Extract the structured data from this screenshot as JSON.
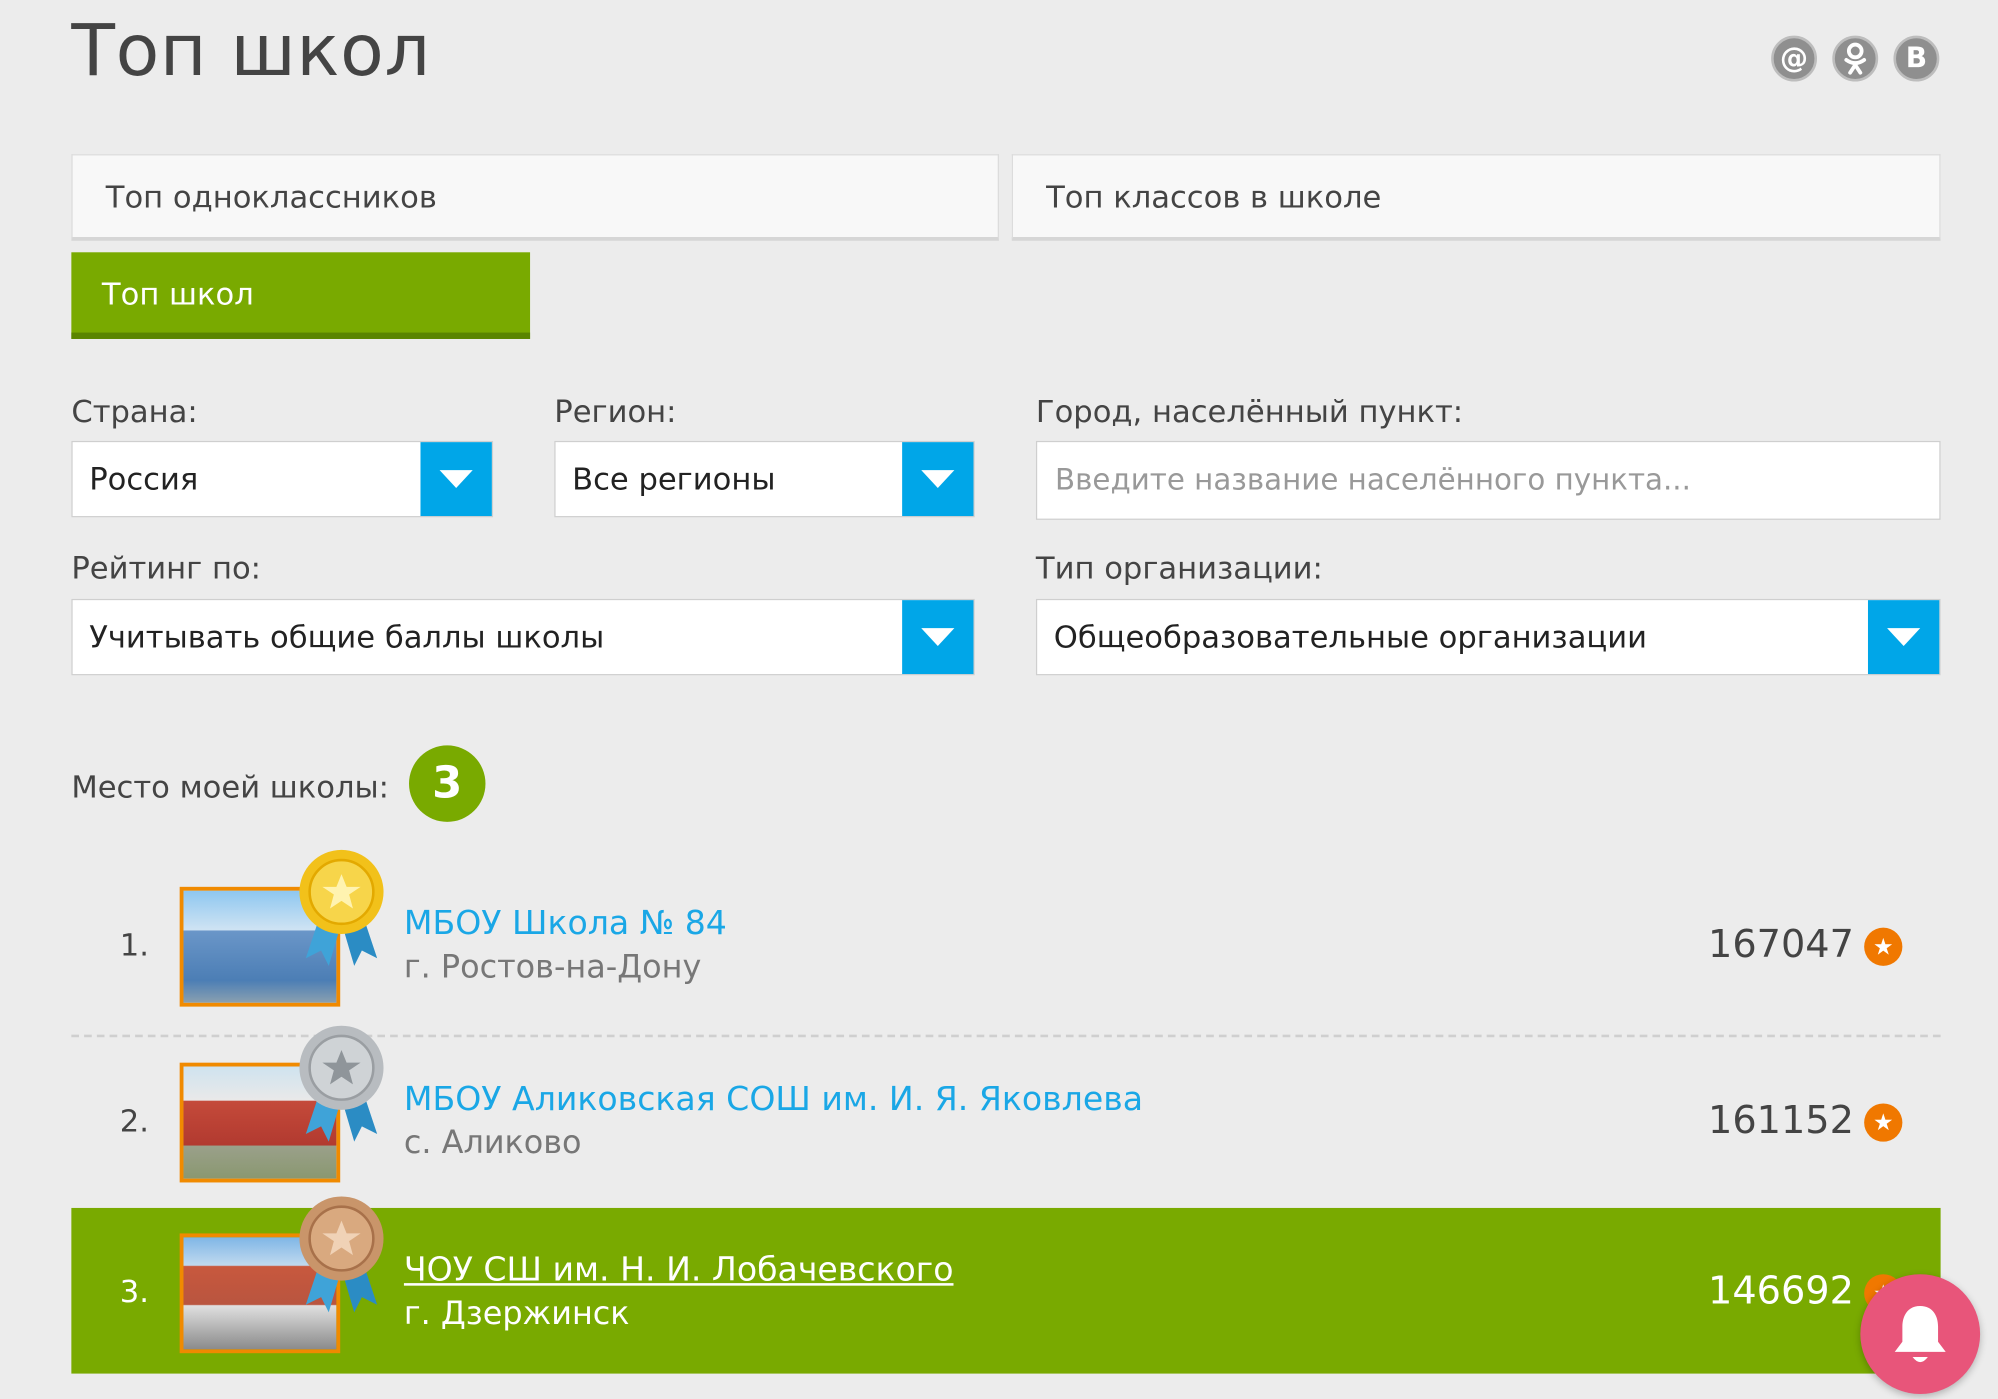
{
  "page": {
    "title": "Топ школ"
  },
  "social": [
    {
      "icon": "mail-icon",
      "glyph": "@"
    },
    {
      "icon": "odnoklassniki-icon",
      "glyph": "ок"
    },
    {
      "icon": "vk-icon",
      "glyph": "В"
    }
  ],
  "tabs": [
    {
      "label": "Топ одноклассников",
      "active": false
    },
    {
      "label": "Топ классов в школе",
      "active": false
    },
    {
      "label": "Топ школ",
      "active": true
    }
  ],
  "filters": {
    "country": {
      "label": "Страна:",
      "value": "Россия"
    },
    "region": {
      "label": "Регион:",
      "value": "Все регионы"
    },
    "city": {
      "label": "Город, населённый пункт:",
      "placeholder": "Введите название населённого пункта..."
    },
    "rating": {
      "label": "Рейтинг по:",
      "value": "Учитывать общие баллы школы"
    },
    "org_type": {
      "label": "Тип организации:",
      "value": "Общеобразовательные организации"
    }
  },
  "my_place": {
    "label": "Место моей школы:",
    "value": "3"
  },
  "schools": [
    {
      "rank": "1.",
      "name": "МБОУ Школа № 84",
      "city": "г. Ростов-на-Дону",
      "score": "167047",
      "medal": "gold"
    },
    {
      "rank": "2.",
      "name": "МБОУ Аликовская СОШ им. И. Я. Яковлева",
      "city": "с. Аликово",
      "score": "161152",
      "medal": "silver"
    },
    {
      "rank": "3.",
      "name": "ЧОУ СШ им. Н. И. Лобачевского",
      "city": "г. Дзержинск",
      "score": "146692",
      "medal": "bronze",
      "highlighted": true
    }
  ],
  "colors": {
    "accent_green": "#79aa00",
    "dropdown_blue": "#00a6e8",
    "link_blue": "#1aa7e6",
    "star_orange": "#f07800",
    "bell_pink": "#e8557a"
  }
}
